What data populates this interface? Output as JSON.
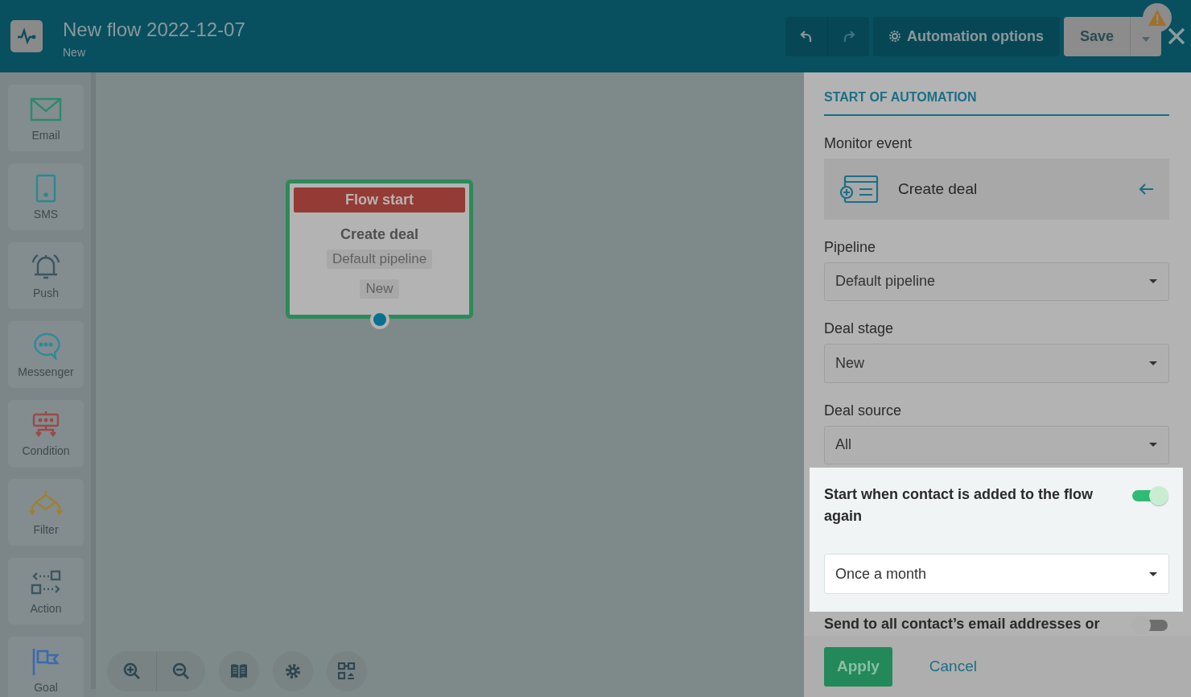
{
  "header": {
    "title": "New flow 2022-12-07",
    "subtitle": "New",
    "undo": {
      "disabled": false
    },
    "redo": {
      "disabled": true
    },
    "options_button": "Automation options",
    "save_button": "Save",
    "warning": true
  },
  "sidebar": {
    "items": [
      {
        "kind": "email",
        "label": "Email"
      },
      {
        "kind": "sms",
        "label": "SMS"
      },
      {
        "kind": "push",
        "label": "Push"
      },
      {
        "kind": "messenger",
        "label": "Messenger"
      },
      {
        "kind": "condition",
        "label": "Condition"
      },
      {
        "kind": "filter",
        "label": "Filter"
      },
      {
        "kind": "action",
        "label": "Action"
      },
      {
        "kind": "goal",
        "label": "Goal"
      }
    ]
  },
  "canvas": {
    "node": {
      "header": "Flow start",
      "title": "Create deal",
      "tags": [
        "Default pipeline",
        "New"
      ],
      "selected": true
    }
  },
  "panel": {
    "section_title": "START OF AUTOMATION",
    "monitor_event": {
      "label": "Monitor event",
      "value": "Create deal"
    },
    "selects": [
      {
        "label": "Pipeline",
        "value": "Default pipeline"
      },
      {
        "label": "Deal stage",
        "value": "New"
      },
      {
        "label": "Deal source",
        "value": "All"
      }
    ],
    "repeat": {
      "label": "Start when contact is added to the flow again",
      "on": true,
      "value": "Once a month"
    },
    "send_all": {
      "label": "Send to all contact’s email addresses or",
      "on": false
    },
    "apply_button": "Apply",
    "cancel_link": "Cancel"
  }
}
